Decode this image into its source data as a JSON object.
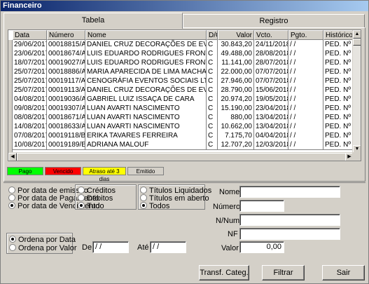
{
  "window": {
    "title": "Financeiro"
  },
  "tabs": [
    {
      "label": "Tabela",
      "active": true
    },
    {
      "label": "Registro",
      "active": false
    }
  ],
  "table": {
    "columns": [
      "Data",
      "Número",
      "Nome",
      "D/C",
      "Valor",
      "Vcto.",
      "Pgto.",
      "Histórico"
    ],
    "rows": [
      [
        "29/06/2017",
        "00018815/A",
        "DANIEL CRUZ DECORAÇÕES DE EVENT",
        "C",
        "30.843,20",
        "24/11/2018",
        "/ /",
        "PED. Nº 0"
      ],
      [
        "23/06/2017",
        "00018674/A",
        "LUIS EDUARDO RODRIGUES FRONTER",
        "C",
        "49.488,00",
        "28/08/2018",
        "/ /",
        "PED. Nº 0"
      ],
      [
        "18/07/2017",
        "00019027/A",
        "LUIS EDUARDO RODRIGUES FRONTER",
        "C",
        "11.141,00",
        "28/07/2018",
        "/ /",
        "PED. Nº 0"
      ],
      [
        "25/07/2017",
        "00018886/A",
        "MARIA APARECIDA DE LIMA MACHADO Z",
        "C",
        "22.000,00",
        "07/07/2018",
        "/ /",
        "PED. Nº 0"
      ],
      [
        "25/07/2017",
        "00019117/A",
        "CENOGRÁFIA EVENTOS SOCIAIS LTDA",
        "C",
        "27.946,00",
        "07/07/2018",
        "/ /",
        "PED. Nº 0"
      ],
      [
        "25/07/2017",
        "00019113/A",
        "DANIEL CRUZ DECORAÇÕES DE EVENT",
        "C",
        "28.790,00",
        "15/06/2018",
        "/ /",
        "PED. Nº 0"
      ],
      [
        "04/08/2017",
        "00019036/A",
        "GABRIEL LUIZ ISSAÇA DE CARA",
        "C",
        "20.974,20",
        "19/05/2018",
        "/ /",
        "PED. Nº 0"
      ],
      [
        "09/08/2017",
        "00019307/A",
        "LUAN AVARTI NASCIMENTO",
        "C",
        "15.190,00",
        "23/04/2018",
        "/ /",
        "PED. Nº 0"
      ],
      [
        "08/08/2017",
        "00018671/A",
        "LUAN AVARTI NASCIMENTO",
        "C",
        "880,00",
        "13/04/2018",
        "/ /",
        "PED. Nº 0"
      ],
      [
        "14/08/2017",
        "00018633/A",
        "LUAN AVARTI NASCIMENTO",
        "C",
        "10.662,00",
        "13/04/2018",
        "/ /",
        "PED. Nº 0"
      ],
      [
        "07/08/2017",
        "00019118/B",
        "ERIKA TAVARES FERREIRA",
        "C",
        "7.175,70",
        "04/04/2018",
        "/ /",
        "PED. Nº 0"
      ],
      [
        "10/08/2017",
        "00019189/B",
        "ADRIANA MALOUF",
        "C",
        "12.707,20",
        "12/03/2018",
        "/ /",
        "PED. Nº 0"
      ]
    ]
  },
  "legend": [
    {
      "label": "Pago",
      "color": "#00ff00"
    },
    {
      "label": "Vencido",
      "color": "#ff0000"
    },
    {
      "label": "Atraso até 3 dias",
      "color": "#ffff00"
    },
    {
      "label": "Emitido",
      "color": "#d4d0c8"
    }
  ],
  "date_options": [
    {
      "label": "Por data de emissão",
      "checked": false
    },
    {
      "label": "Por data de Pagamento",
      "checked": false
    },
    {
      "label": "Por data de Vencimento",
      "checked": true
    }
  ],
  "type_options": [
    {
      "label": "Créditos",
      "checked": false
    },
    {
      "label": "Débitos",
      "checked": false
    },
    {
      "label": "Tudo",
      "checked": true
    }
  ],
  "status_options": [
    {
      "label": "Títulos Liquidados",
      "checked": false
    },
    {
      "label": "Títulos em aberto",
      "checked": false
    },
    {
      "label": "Todos",
      "checked": true
    }
  ],
  "order_options": [
    {
      "label": "Ordena por Data",
      "checked": true
    },
    {
      "label": "Ordena por Valor",
      "checked": false
    }
  ],
  "filters": {
    "de_label": "De",
    "de_value": "/ /",
    "ate_label": "Até",
    "ate_value": "/ /",
    "nome_label": "Nome",
    "nome_value": "",
    "numero_label": "Número",
    "numero_value": "",
    "nnum_label": "N/Num",
    "nnum_value": "",
    "nf_label": "NF",
    "nf_value": "",
    "valor_label": "Valor",
    "valor_value": "0,00"
  },
  "buttons": {
    "transf_categ": "Transf. Categ.",
    "filtrar": "Filtrar",
    "sair": "Sair"
  }
}
